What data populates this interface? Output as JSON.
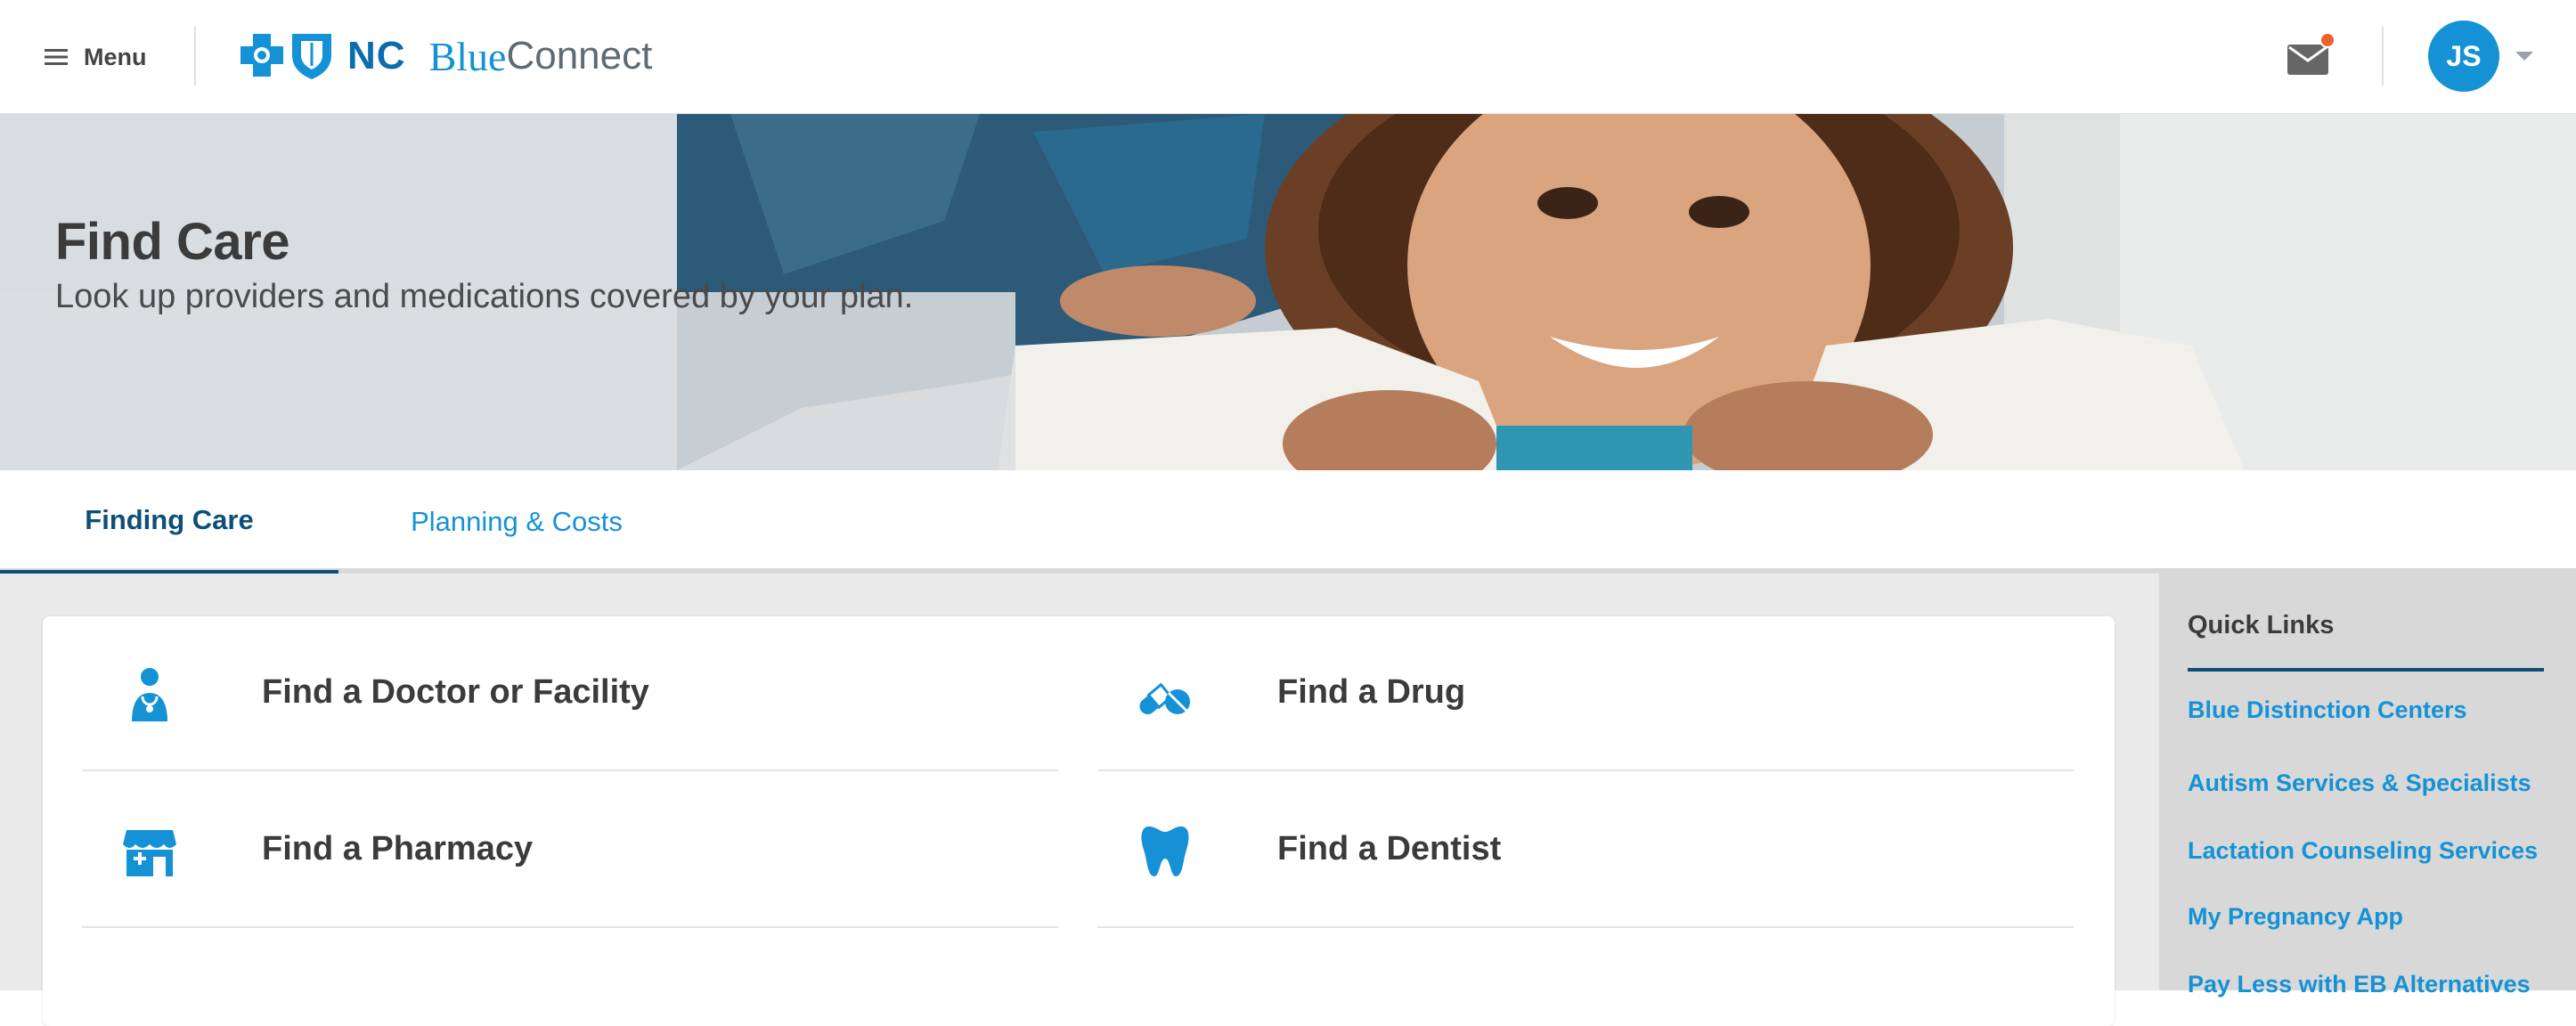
{
  "header": {
    "menu_label": "Menu",
    "logo_state": "NC",
    "logo_blue": "Blue",
    "logo_connect": "Connect",
    "user_initials": "JS",
    "mail_has_notification": true,
    "brand_color": "#1592d6",
    "notification_color": "#e8642c"
  },
  "hero": {
    "title": "Find Care",
    "subtitle": "Look up providers and medications covered by your plan."
  },
  "tabs": [
    {
      "label": "Finding Care",
      "active": true
    },
    {
      "label": "Planning & Costs",
      "active": false
    }
  ],
  "actions": [
    {
      "label": "Find a Doctor or Facility",
      "icon": "doctor-icon"
    },
    {
      "label": "Find a Drug",
      "icon": "pills-icon"
    },
    {
      "label": "Find a Pharmacy",
      "icon": "pharmacy-store-icon"
    },
    {
      "label": "Find a Dentist",
      "icon": "tooth-icon"
    }
  ],
  "quick_links": {
    "title": "Quick Links",
    "items": [
      "Blue Distinction Centers",
      "Autism Services & Specialists",
      "Lactation Counseling Services",
      "My Pregnancy App",
      "Pay Less with EB Alternatives"
    ]
  }
}
